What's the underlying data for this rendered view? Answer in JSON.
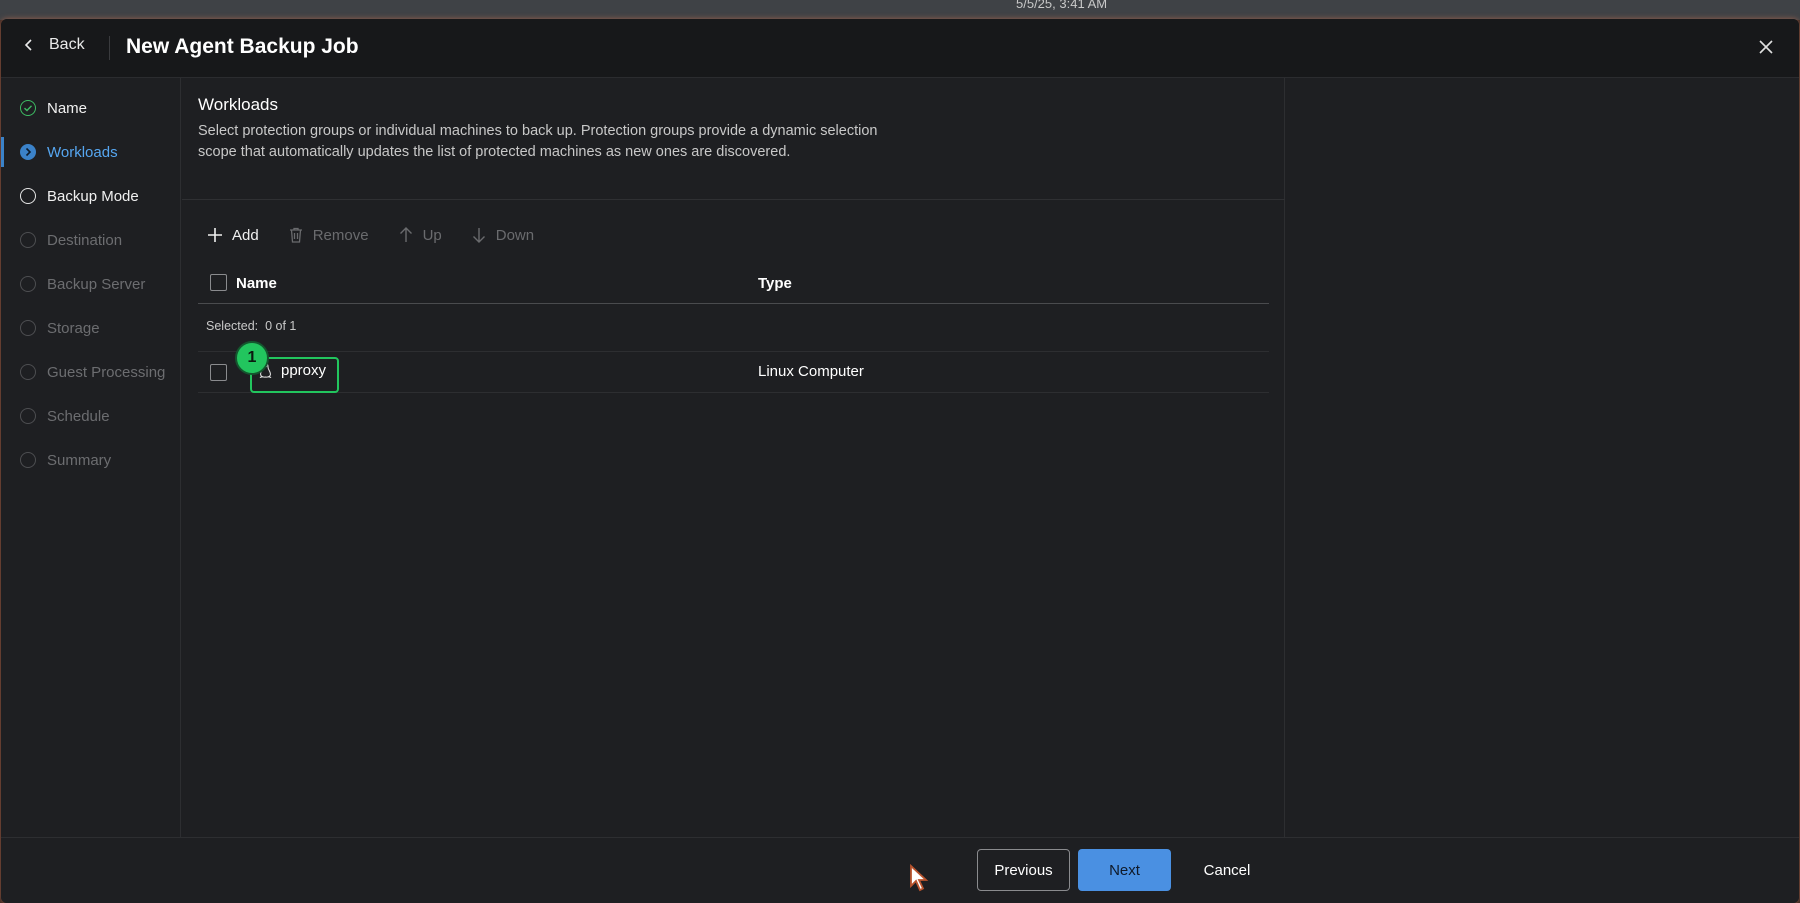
{
  "top_strip": {
    "text": "5/5/25, 3:41 AM"
  },
  "header": {
    "back_label": "Back",
    "title": "New Agent Backup Job"
  },
  "sidebar": {
    "steps": [
      {
        "label": "Name",
        "state": "done"
      },
      {
        "label": "Workloads",
        "state": "active"
      },
      {
        "label": "Backup Mode",
        "state": "next"
      },
      {
        "label": "Destination",
        "state": "todo"
      },
      {
        "label": "Backup Server",
        "state": "todo"
      },
      {
        "label": "Storage",
        "state": "todo"
      },
      {
        "label": "Guest Processing",
        "state": "todo"
      },
      {
        "label": "Schedule",
        "state": "todo"
      },
      {
        "label": "Summary",
        "state": "todo"
      }
    ]
  },
  "main": {
    "section_title": "Workloads",
    "section_description": "Select protection groups or individual machines to back up. Protection groups provide a dynamic selection scope that automatically updates the list of protected machines as new ones are discovered.",
    "toolbar": {
      "add_label": "Add",
      "remove_label": "Remove",
      "up_label": "Up",
      "down_label": "Down"
    },
    "table": {
      "columns": [
        "Name",
        "Type"
      ],
      "selected_label": "Selected:",
      "selected_value": "0 of 1",
      "rows": [
        {
          "name": "pproxy",
          "type": "Linux Computer",
          "icon": "linux-icon"
        }
      ]
    },
    "annotation_badge": "1"
  },
  "footer": {
    "previous_label": "Previous",
    "next_label": "Next",
    "cancel_label": "Cancel"
  },
  "colors": {
    "accent": "#4a90e2",
    "active_step": "#56a6f0",
    "done_step": "#3dbb63",
    "highlight": "#22c55e",
    "background": "#1e1f22"
  }
}
